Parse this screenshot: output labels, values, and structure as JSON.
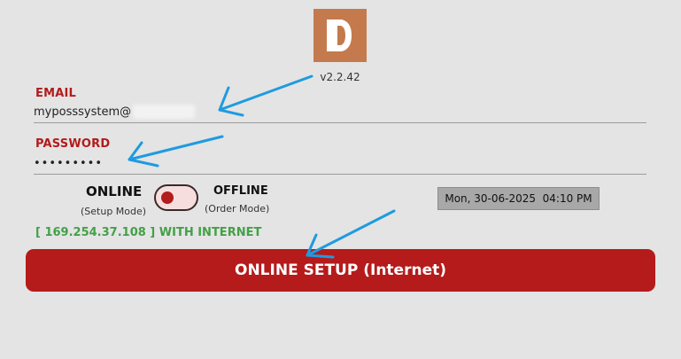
{
  "app": {
    "version": "v2.2.42"
  },
  "login": {
    "email_label": "EMAIL",
    "email_value": "myposssystem@",
    "password_label": "PASSWORD",
    "password_value": "•••••••••"
  },
  "mode": {
    "online_label": "ONLINE",
    "online_sub": "(Setup Mode)",
    "offline_label": "OFFLINE",
    "offline_sub": "(Order Mode)",
    "toggle_state": "online"
  },
  "datetime": "Mon, 30-06-2025  04:10 PM",
  "connection_status": "[ 169.254.37.108 ] WITH INTERNET",
  "setup_button_label": "ONLINE SETUP (Internet)",
  "colors": {
    "brand_red": "#b51b1b",
    "logo_bg": "#c57a4d",
    "status_green": "#43a047",
    "annotation_blue": "#1e9be0"
  },
  "icons": {
    "logo": "d-logo-icon",
    "annotation": "arrow-annotation-icon"
  }
}
